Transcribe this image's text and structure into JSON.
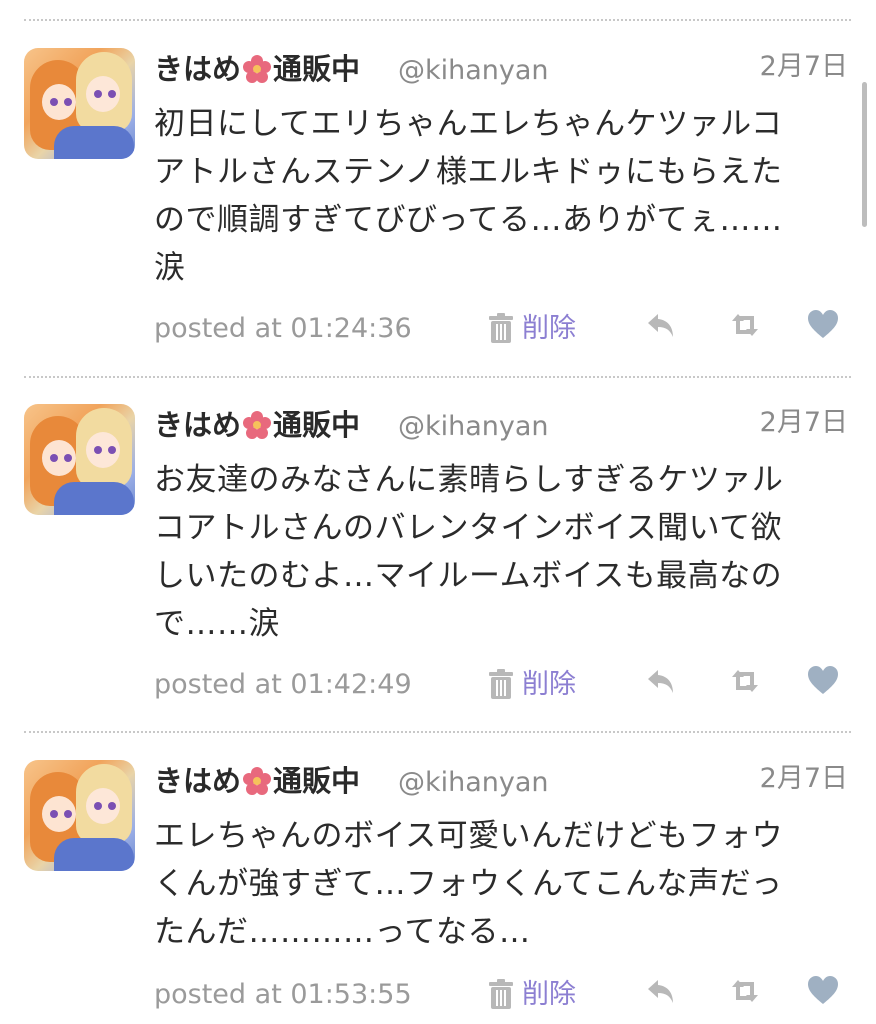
{
  "tweets": [
    {
      "author_name": "きはめ",
      "author_suffix": "通販中",
      "handle": "@kihanyan",
      "date": "2月7日",
      "lines": [
        "初日にしてエリちゃんエレちゃんケツァルコ",
        "アトルさんステンノ様エルキドゥにもらえた",
        "ので順調すぎてびびってる…ありがてぇ……",
        "涙"
      ],
      "posted_label": "posted at 01:24:36",
      "delete_label": "削除"
    },
    {
      "author_name": "きはめ",
      "author_suffix": "通販中",
      "handle": "@kihanyan",
      "date": "2月7日",
      "lines": [
        "お友達のみなさんに素晴らしすぎるケツァル",
        "コアトルさんのバレンタインボイス聞いて欲",
        "しいたのむよ…マイルームボイスも最高なの",
        "で……涙"
      ],
      "posted_label": "posted at 01:42:49",
      "delete_label": "削除"
    },
    {
      "author_name": "きはめ",
      "author_suffix": "通販中",
      "handle": "@kihanyan",
      "date": "2月7日",
      "lines": [
        "エレちゃんのボイス可愛いんだけどもフォウ",
        "くんが強すぎて…フォウくんてこんな声だっ",
        "たんだ…………ってなる…"
      ],
      "posted_label": "posted at 01:53:55",
      "delete_label": "削除"
    }
  ],
  "icons": {
    "flower": "hibiscus-icon",
    "delete": "trash-icon",
    "reply": "reply-icon",
    "retweet": "retweet-icon",
    "like": "heart-icon"
  },
  "colors": {
    "accent": "#8c7fd2",
    "meta_text": "#9a9a9a",
    "icon_gray": "#b8b8b8",
    "heart": "#9fb0c2",
    "flower": "#e8697d"
  }
}
